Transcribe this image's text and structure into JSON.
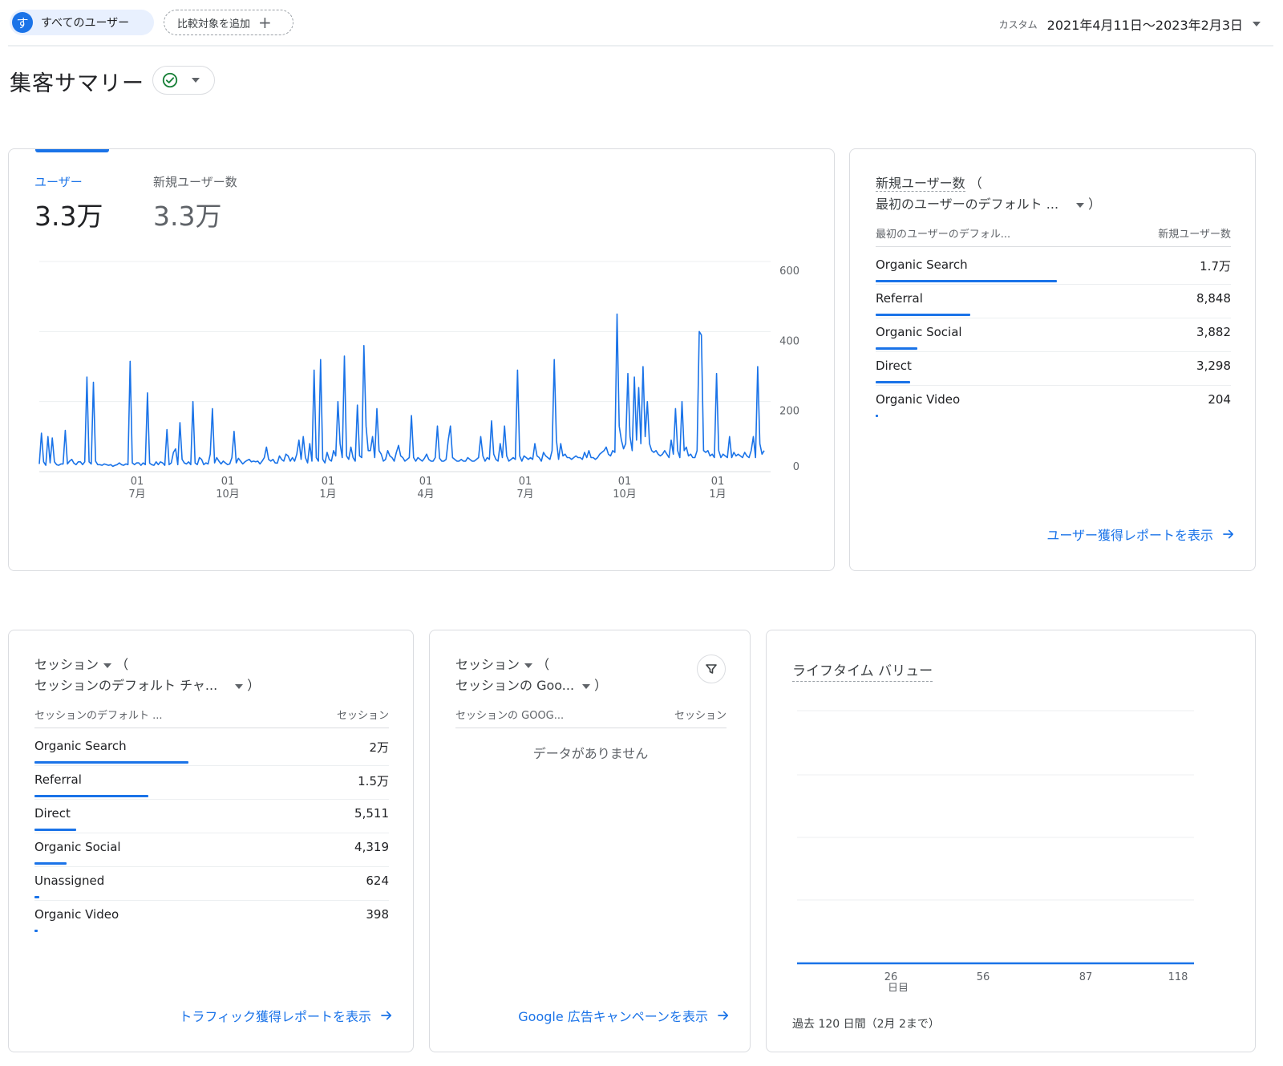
{
  "topbar": {
    "segment_avatar": "す",
    "segment_label": "すべてのユーザー",
    "compare_label": "比較対象を追加",
    "compare_plus": "+",
    "date_custom": "カスタム",
    "date_range": "2021年4月11日～2023年2月3日"
  },
  "page": {
    "title": "集客サマリー"
  },
  "colors": {
    "accent": "#1a73e8",
    "success": "#188038"
  },
  "main_card": {
    "metrics": [
      {
        "label": "ユーザー",
        "value": "3.3万"
      },
      {
        "label": "新規ユーザー数",
        "value": "3.3万"
      }
    ],
    "chart_data": {
      "type": "line",
      "series": [
        {
          "values": [
            22,
            110,
            28,
            18,
            100,
            25,
            96,
            28,
            20,
            18,
            22,
            22,
            118,
            22,
            30,
            35,
            24,
            20,
            28,
            28,
            20,
            28,
            270,
            28,
            22,
            255,
            30,
            20,
            20,
            18,
            22,
            20,
            18,
            20,
            15,
            18,
            20,
            25,
            20,
            18,
            22,
            20,
            315,
            25,
            20,
            25,
            25,
            18,
            25,
            20,
            225,
            24,
            20,
            18,
            28,
            20,
            28,
            25,
            18,
            120,
            20,
            25,
            55,
            65,
            20,
            140,
            35,
            25,
            22,
            28,
            20,
            200,
            25,
            20,
            40,
            35,
            20,
            25,
            22,
            50,
            180,
            25,
            40,
            30,
            22,
            30,
            25,
            20,
            22,
            40,
            115,
            25,
            38,
            30,
            22,
            28,
            32,
            35,
            28,
            30,
            28,
            30,
            22,
            30,
            40,
            70,
            35,
            30,
            35,
            25,
            24,
            45,
            35,
            30,
            50,
            45,
            30,
            40,
            30,
            50,
            90,
            35,
            100,
            40,
            25,
            80,
            30,
            290,
            40,
            30,
            320,
            35,
            25,
            55,
            35,
            30,
            60,
            45,
            200,
            80,
            40,
            330,
            45,
            35,
            70,
            40,
            30,
            190,
            45,
            40,
            360,
            130,
            60,
            60,
            100,
            40,
            180,
            60,
            50,
            30,
            35,
            60,
            45,
            40,
            30,
            55,
            75,
            45,
            40,
            30,
            35,
            40,
            160,
            40,
            30,
            40,
            35,
            30,
            38,
            50,
            35,
            30,
            30,
            40,
            130,
            38,
            30,
            30,
            35,
            90,
            130,
            40,
            35,
            30,
            30,
            35,
            30,
            30,
            40,
            35,
            30,
            30,
            35,
            40,
            100,
            45,
            30,
            40,
            35,
            145,
            50,
            35,
            30,
            80,
            40,
            130,
            45,
            30,
            35,
            40,
            35,
            290,
            45,
            30,
            45,
            40,
            35,
            40,
            35,
            80,
            45,
            40,
            30,
            55,
            45,
            40,
            35,
            60,
            320,
            90,
            35,
            80,
            45,
            50,
            40,
            40,
            35,
            40,
            45,
            40,
            40,
            35,
            55,
            40,
            60,
            40,
            40,
            35,
            40,
            50,
            55,
            60,
            70,
            50,
            45,
            60,
            55,
            450,
            130,
            90,
            65,
            80,
            280,
            100,
            60,
            270,
            90,
            240,
            80,
            300,
            100,
            200,
            80,
            60,
            55,
            60,
            50,
            45,
            50,
            60,
            50,
            40,
            90,
            50,
            180,
            60,
            40,
            200,
            60,
            70,
            45,
            50,
            40,
            40,
            60,
            400,
            390,
            60,
            55,
            60,
            45,
            50,
            40,
            280,
            60,
            40,
            50,
            45,
            40,
            100,
            40,
            55,
            45,
            50,
            45,
            40,
            55,
            45,
            40,
            60,
            100,
            40,
            300,
            80,
            50,
            60
          ]
        }
      ],
      "x_ticks": [
        {
          "day": "01",
          "month": "7月"
        },
        {
          "day": "01",
          "month": "10月"
        },
        {
          "day": "01",
          "month": "1月"
        },
        {
          "day": "01",
          "month": "4月"
        },
        {
          "day": "01",
          "month": "7月"
        },
        {
          "day": "01",
          "month": "10月"
        },
        {
          "day": "01",
          "month": "1月"
        }
      ],
      "y_ticks": [
        "600",
        "400",
        "200",
        "0"
      ],
      "ylim": [
        0,
        600
      ]
    }
  },
  "new_users_card": {
    "title_line1": "新規ユーザー数",
    "title_paren_open": "（",
    "title_line2": "最初のユーザーのデフォルト ...",
    "title_paren_close": "）",
    "col_dimension": "最初のユーザーのデフォル...",
    "col_metric": "新規ユーザー数",
    "rows": [
      {
        "label": "Organic Search",
        "value": "1.7万",
        "ratio": 1.0
      },
      {
        "label": "Referral",
        "value": "8,848",
        "ratio": 0.52
      },
      {
        "label": "Organic Social",
        "value": "3,882",
        "ratio": 0.23
      },
      {
        "label": "Direct",
        "value": "3,298",
        "ratio": 0.19
      },
      {
        "label": "Organic Video",
        "value": "204",
        "ratio": 0.012
      }
    ],
    "link": "ユーザー獲得レポートを表示"
  },
  "sessions_card": {
    "title_line1": "セッション",
    "title_paren_open": "（",
    "title_line2": "セッションのデフォルト チャ...",
    "title_paren_close": "）",
    "col_dimension": "セッションのデフォルト ...",
    "col_metric": "セッション",
    "rows": [
      {
        "label": "Organic Search",
        "value": "2万",
        "ratio": 1.0
      },
      {
        "label": "Referral",
        "value": "1.5万",
        "ratio": 0.74
      },
      {
        "label": "Direct",
        "value": "5,511",
        "ratio": 0.27
      },
      {
        "label": "Organic Social",
        "value": "4,319",
        "ratio": 0.21
      },
      {
        "label": "Unassigned",
        "value": "624",
        "ratio": 0.03
      },
      {
        "label": "Organic Video",
        "value": "398",
        "ratio": 0.02
      }
    ],
    "link": "トラフィック獲得レポートを表示"
  },
  "google_card": {
    "title_line1": "セッション",
    "title_paren_open": "（",
    "title_line2": "セッションの Goo...",
    "title_paren_close": "）",
    "col_dimension": "セッションの GOOG...",
    "col_metric": "セッション",
    "empty": "データがありません",
    "link": "Google 広告キャンペーンを表示"
  },
  "ltv_card": {
    "title": "ライフタイム バリュー",
    "x_ticks": [
      "26",
      "56",
      "87",
      "118"
    ],
    "x_unit": "日目",
    "footer": "過去 120 日間（2月 2まで）"
  }
}
